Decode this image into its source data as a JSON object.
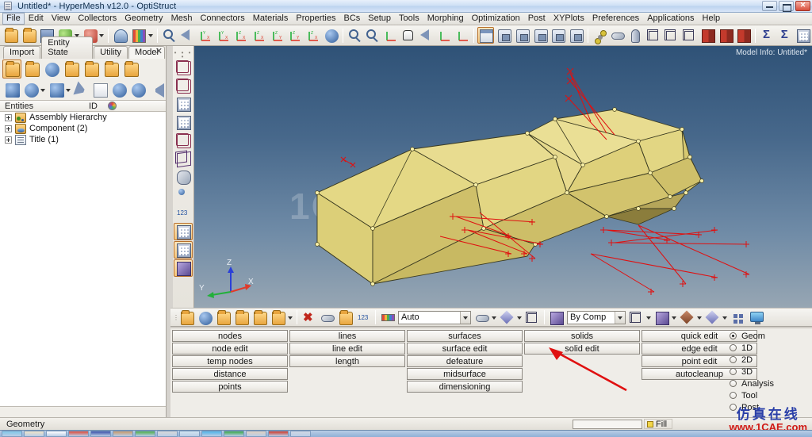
{
  "window": {
    "title": "Untitled* - HyperMesh v12.0 - OptiStruct",
    "icon": "application-icon",
    "controls": {
      "minimize": "minimize-button",
      "maximize": "restore-button",
      "close": "close-button"
    }
  },
  "menu": {
    "items": [
      "File",
      "Edit",
      "View",
      "Collectors",
      "Geometry",
      "Mesh",
      "Connectors",
      "Materials",
      "Properties",
      "BCs",
      "Setup",
      "Tools",
      "Morphing",
      "Optimization",
      "Post",
      "XYPlots",
      "Preferences",
      "Applications",
      "Help"
    ]
  },
  "toolbar": {
    "groups": [
      {
        "name": "file",
        "icons": [
          "open-model-icon",
          "import-icon",
          "save-icon",
          "export-solver-icon",
          "export-geometry-icon"
        ]
      },
      {
        "name": "session",
        "icons": [
          "user-profile-icon",
          "color-palette-icon"
        ]
      },
      {
        "name": "view",
        "icons": [
          "zoom-fit-icon",
          "back-view-icon",
          "xy-view-icon",
          "yx-view-icon",
          "xz-view-icon",
          "zx-view-icon",
          "zy-view-icon",
          "yz-view-icon",
          "iso-view-icon",
          "rotate-view-icon"
        ]
      },
      {
        "name": "navigate",
        "icons": [
          "zoom-in-icon",
          "zoom-out-icon",
          "fit-icon",
          "pan-icon",
          "arrow-left-icon",
          "arrow-updown-icon",
          "parentheses-icon"
        ]
      },
      {
        "name": "display",
        "icons": [
          "window-tile-icon",
          "window-1-icon",
          "window-2-icon",
          "window-3-icon",
          "window-4-icon",
          "window-single-icon"
        ]
      },
      {
        "name": "mesh",
        "icons": [
          "node-line-icon",
          "rod-icon",
          "cylinder-icon",
          "wire-cube-icon",
          "shaded-cube-icon",
          "solid-cube-icon",
          "book-red-icon",
          "book-blue-icon",
          "book-arrow-icon"
        ]
      },
      {
        "name": "summary",
        "icons": [
          "sigma-icon",
          "sigma-detail-icon",
          "matrix-icon"
        ]
      }
    ]
  },
  "left_panel": {
    "tabs": [
      {
        "label": "Model",
        "active": true
      },
      {
        "label": "Utility",
        "active": false
      },
      {
        "label": "Entity State",
        "active": false
      },
      {
        "label": "Import",
        "active": false
      }
    ],
    "close_label": "✕",
    "toolbar_row1": [
      "new-folder-icon",
      "assembly-icon",
      "component-icon",
      "load-collector-icon",
      "property-icon",
      "material-icon",
      "group-icon"
    ],
    "toolbar_row2": [
      "display-icon",
      "component-color-icon",
      "component-display-icon",
      "cursor-icon",
      "lock-icon",
      "show-hide-icon",
      "isolate-icon",
      "reverse-icon"
    ],
    "tree_header": {
      "entities": "Entities",
      "id": "ID",
      "color": "color-wheel-icon"
    },
    "tree_items": [
      {
        "label": "Assembly Hierarchy",
        "icon": "assembly-hierarchy-icon"
      },
      {
        "label": "Component (2)",
        "icon": "component-icon"
      },
      {
        "label": "Title (1)",
        "icon": "title-icon"
      }
    ]
  },
  "vertical_strip": {
    "icons": [
      "mesh-display-icon",
      "mesh-arrow-icon",
      "mesh-grid-icon",
      "mesh-plain-icon",
      "mesh-box-icon",
      "mesh-circle-icon",
      "mesh-ribbon-icon",
      "node-id-icon",
      "numbers-123-icon",
      "abc-label-icon",
      "abc-arrow-icon",
      "shrink-icon"
    ]
  },
  "graphics": {
    "model_info": "Model Info: Untitled*",
    "watermark": "1CAE.COM",
    "axis_triad": {
      "x": "X",
      "y": "Y",
      "z": "Z",
      "x_color": "#e03a2a",
      "y_color": "#22b03a",
      "z_color": "#2a3fd8"
    },
    "model_color": "#e0d27a",
    "edge_color": "#2a2a1a",
    "marker_color": "#e01010",
    "background_top": "#2f5277",
    "background_bottom": "#97a6b3"
  },
  "graphics_toolbar": {
    "left_icons": [
      "assembly-icon",
      "component-icon",
      "property-icon",
      "material-icon",
      "load-icon",
      "group-icon"
    ],
    "delete_icon": "delete-icon",
    "mask_icons": [
      "mask-icon",
      "unmask-icon",
      "numbering-icon"
    ],
    "mode_label": "Auto",
    "mode_icons": [
      "surface-icon",
      "shaded-surface-icon",
      "solid-icon"
    ],
    "by_comp_label": "By Comp",
    "right_icons": [
      "wireframe-cube-icon",
      "shaded-cube-icon",
      "brown-diamond-icon",
      "blue-diamond-icon",
      "dots-icon",
      "monitor-icon"
    ]
  },
  "command_panel": {
    "columns": [
      {
        "name": "nodes-column",
        "buttons": [
          "nodes",
          "node edit",
          "temp nodes",
          "distance",
          "points"
        ]
      },
      {
        "name": "lines-column",
        "buttons": [
          "lines",
          "line edit",
          "length"
        ]
      },
      {
        "name": "surfaces-column",
        "buttons": [
          "surfaces",
          "surface edit",
          "defeature",
          "midsurface",
          "dimensioning"
        ]
      },
      {
        "name": "solids-column",
        "buttons": [
          "solids",
          "solid edit"
        ]
      },
      {
        "name": "edit-column",
        "buttons": [
          "quick edit",
          "edge edit",
          "point edit",
          "autocleanup"
        ]
      }
    ],
    "radio_options": [
      {
        "label": "Geom",
        "selected": true
      },
      {
        "label": "1D",
        "selected": false
      },
      {
        "label": "2D",
        "selected": false
      },
      {
        "label": "3D",
        "selected": false
      },
      {
        "label": "Analysis",
        "selected": false
      },
      {
        "label": "Tool",
        "selected": false
      },
      {
        "label": "Post",
        "selected": false
      }
    ],
    "annotation": "red-arrow-pointing-to-surface-edit"
  },
  "status_bar": {
    "text": "Geometry",
    "field_value": "",
    "fill_label": "Fill"
  },
  "site_watermark": {
    "chinese": "仿真在线",
    "english": "www.1CAE.com"
  },
  "taskbar": {
    "items": [
      "start-orb",
      "app-1",
      "app-2",
      "app-3",
      "app-4",
      "app-5",
      "app-6",
      "app-7",
      "app-8",
      "app-9",
      "app-10",
      "app-11",
      "app-12",
      "app-13"
    ]
  }
}
